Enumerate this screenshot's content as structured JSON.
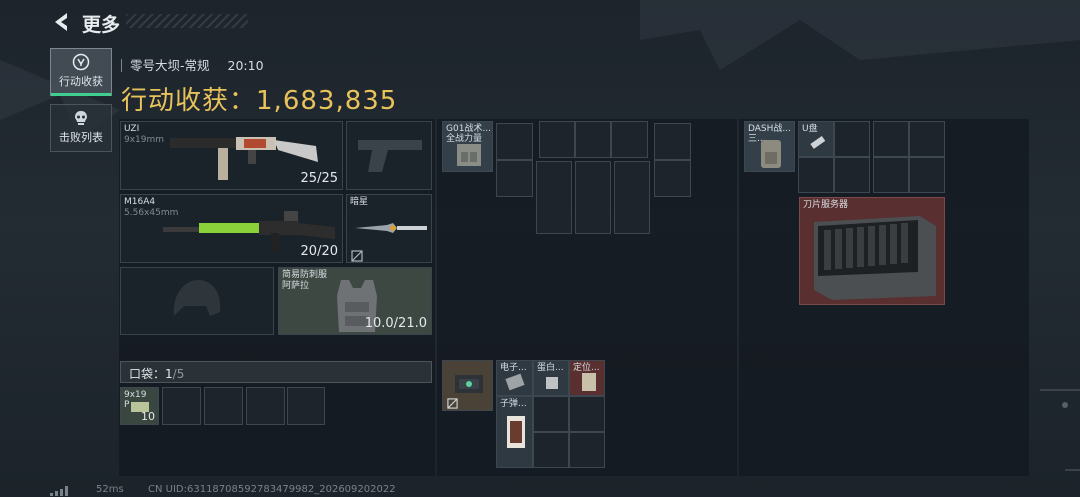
{
  "header": {
    "title": "更多"
  },
  "sidebar": {
    "tabs": [
      {
        "label": "行动收获",
        "active": true
      },
      {
        "label": "击败列表",
        "active": false
      }
    ]
  },
  "match": {
    "map": "零号大坝-常规",
    "time": "20:10"
  },
  "harvest": {
    "label": "行动收获：",
    "value": "1,683,835"
  },
  "weapons": {
    "primary": {
      "name": "UZI",
      "caliber": "9x19mm",
      "ammo": "25/25"
    },
    "secondary": {
      "name": "M16A4",
      "caliber": "5.56x45mm",
      "ammo": "20/20"
    },
    "melee": {
      "name": "暗星"
    }
  },
  "armor": {
    "name": "简易防刺服",
    "variant": "阿萨拉",
    "durability": "10.0/21.0"
  },
  "pocket": {
    "label": "口袋：",
    "count": "1",
    "total": "/5",
    "item": {
      "name": "9x19",
      "sub": "P",
      "qty": "10"
    }
  },
  "chest_rig": {
    "name": "G01战术...",
    "sub": "全战力量"
  },
  "rig_items": [
    {
      "label": "电子..."
    },
    {
      "label": "蛋白..."
    },
    {
      "label": "定位..."
    },
    {
      "label": "子弹..."
    }
  ],
  "backpack": {
    "name": "DASH战...",
    "sub": "三..."
  },
  "bag_items": [
    {
      "label": "U盘"
    },
    {
      "label": "刀片服务器"
    }
  ],
  "status": {
    "ping": "52ms",
    "uid": "CN UID:6311870859278347998​2_202609202022"
  },
  "colors": {
    "accent_gold": "#e8c35b",
    "active_tab": "#3fcf8e",
    "rare_red": "#5a2f30"
  }
}
